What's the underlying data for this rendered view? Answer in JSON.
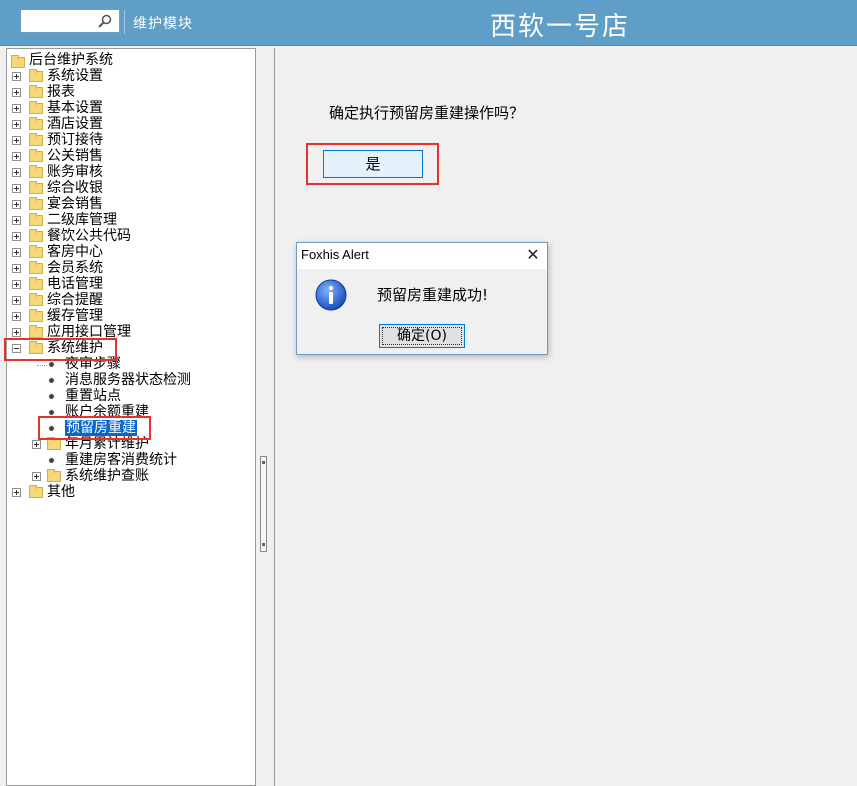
{
  "header": {
    "module_label": "维护模块",
    "store_title": "西软一号店",
    "bg_color": "#5f9ec7"
  },
  "tree": {
    "root": "后台维护系统",
    "items": [
      "系统设置",
      "报表",
      "基本设置",
      "酒店设置",
      "预订接待",
      "公关销售",
      "账务审核",
      "综合收银",
      "宴会销售",
      "二级库管理",
      "餐饮公共代码",
      "客房中心",
      "会员系统",
      "电话管理",
      "综合提醒",
      "缓存管理",
      "应用接口管理"
    ],
    "expanded": "系统维护",
    "children": [
      "夜审步骤",
      "消息服务器状态检测",
      "重置站点",
      "账户余额重建",
      "预留房重建",
      "年月累计维护",
      "重建房客消费统计",
      "系统维护查账"
    ],
    "selected": "预留房重建",
    "last": "其他"
  },
  "content": {
    "prompt": "确定执行预留房重建操作吗？",
    "yes_label": "是"
  },
  "dialog": {
    "title": "Foxhis Alert",
    "close_glyph": "✕",
    "message": "预留房重建成功!",
    "ok_label": "确定(O)"
  },
  "colors": {
    "highlight_red": "#e8312f",
    "selection_blue": "#0a66c9"
  }
}
